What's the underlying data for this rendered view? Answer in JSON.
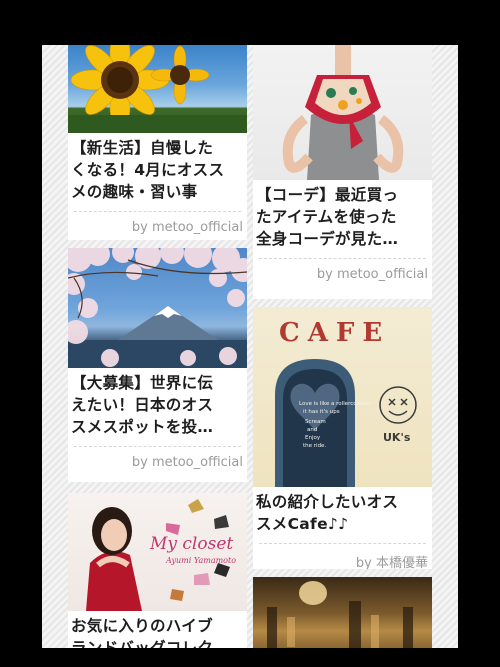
{
  "feed": {
    "left": [
      {
        "photo_name": "sunflower-photo",
        "title_line1": "【新生活】自慢した",
        "title_line2": "くなる！4月にオスス",
        "title_line3": "メの趣味・習い事",
        "author": "by metoo_official"
      },
      {
        "photo_name": "mount-fuji-cherry-blossom-photo",
        "title_line1": "【大募集】世界に伝",
        "title_line2": "えたい！日本のオス",
        "title_line3": "スメスポットを投…",
        "author": "by metoo_official"
      },
      {
        "photo_name": "my-closet-photo",
        "photo_caption": "My closet",
        "photo_caption2": "Ayumi Yamamoto",
        "title_line1": "お気に入りのハイブ",
        "title_line2": "ランドバッグコレク"
      }
    ],
    "right": [
      {
        "photo_name": "scarf-model-photo",
        "title_line1": "【コーデ】最近買っ",
        "title_line2": "たアイテムを使った",
        "title_line3": "全身コーデが見た…",
        "author": "by metoo_official"
      },
      {
        "photo_name": "cafe-door-photo",
        "photo_sign": "CAFE",
        "photo_badge": "UK's",
        "title_line1": "私の紹介したいオス",
        "title_line2": "スメCafe♪♪",
        "author": "by 本橋優華"
      },
      {
        "photo_name": "church-interior-photo"
      }
    ]
  }
}
